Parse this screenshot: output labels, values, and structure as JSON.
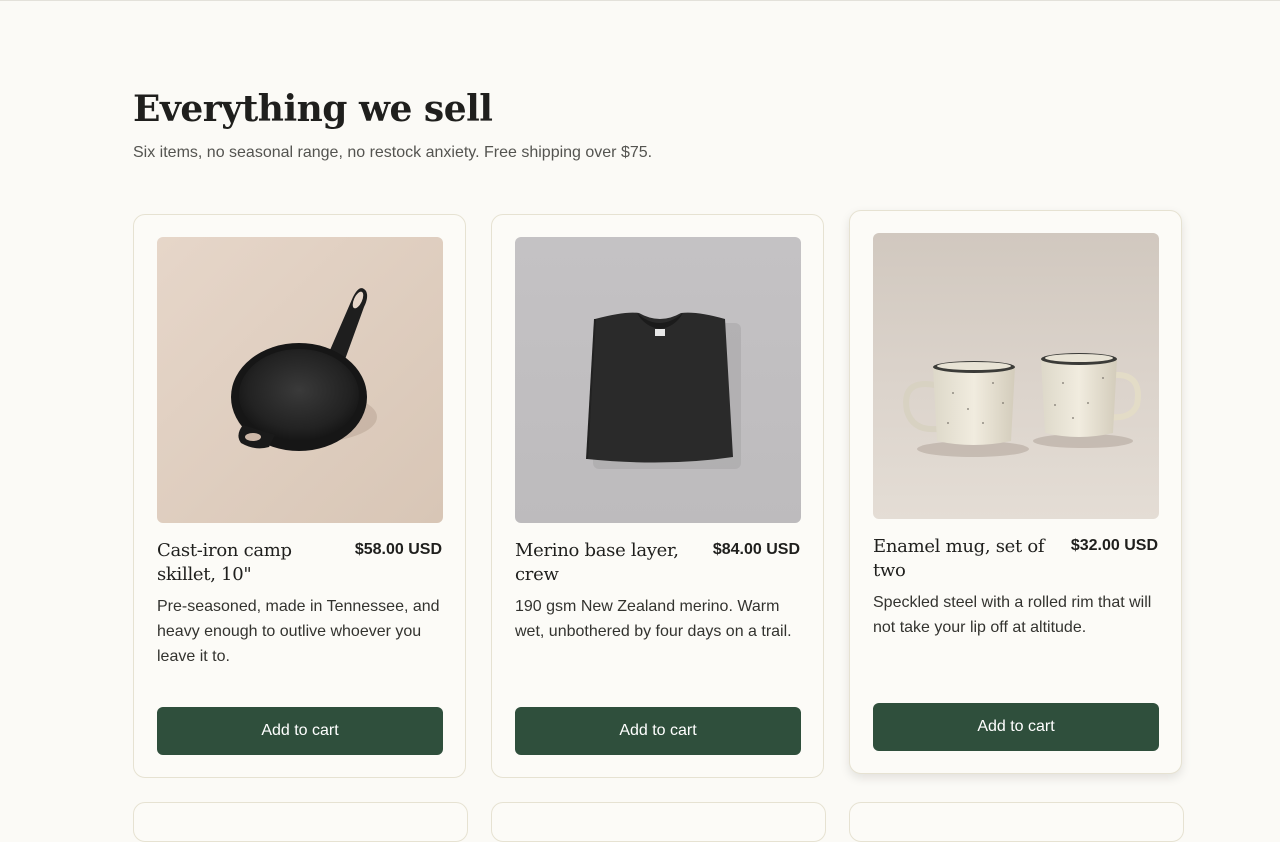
{
  "page": {
    "title": "Everything we sell",
    "subtitle": "Six items, no seasonal range, no restock anxiety. Free shipping over $75."
  },
  "colors": {
    "background": "#fbfaf6",
    "button": "#2f4f3c",
    "card_border": "#e6e2d2"
  },
  "products": [
    {
      "name": "Cast-iron camp skillet, 10\"",
      "price": "$58.00 USD",
      "description": "Pre-seasoned, made in Tennessee, and heavy enough to outlive whoever you leave it to.",
      "button_label": "Add to cart",
      "image": "cast-iron-skillet-photo"
    },
    {
      "name": "Merino base layer, crew",
      "price": "$84.00 USD",
      "description": "190 gsm New Zealand merino. Warm wet, unbothered by four days on a trail.",
      "button_label": "Add to cart",
      "image": "black-merino-shirt-photo"
    },
    {
      "name": "Enamel mug, set of two",
      "price": "$32.00 USD",
      "description": "Speckled steel with a rolled rim that will not take your lip off at altitude.",
      "button_label": "Add to cart",
      "image": "enamel-mugs-photo"
    }
  ]
}
